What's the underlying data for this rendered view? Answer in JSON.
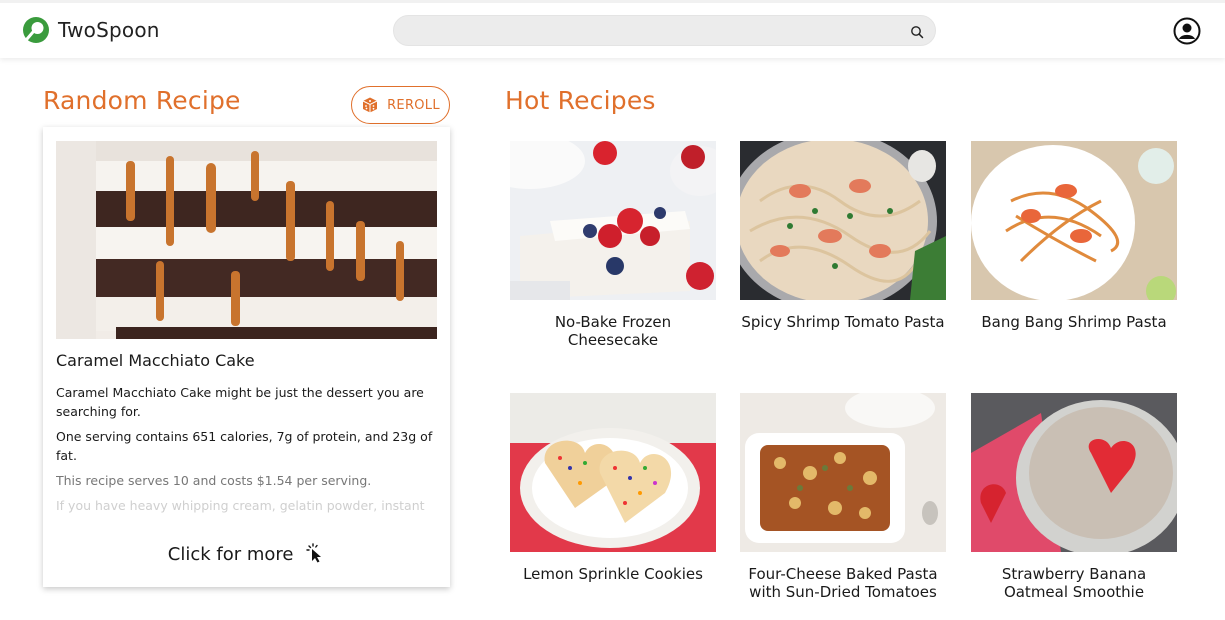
{
  "header": {
    "brand": "TwoSpoon",
    "search": {
      "value": "",
      "placeholder": ""
    },
    "icons": {
      "logo": "twospoon-logo-icon",
      "search": "search-icon",
      "account": "account-circle-icon"
    }
  },
  "random": {
    "title": "Random Recipe",
    "reroll_label": "REROLL",
    "reroll_icon": "dice-icon",
    "recipe_title": "Caramel Macchiato Cake",
    "desc": [
      "Caramel Macchiato Cake might be just the dessert you are searching for.",
      "One serving contains 651 calories, 7g of protein, and 23g of fat.",
      "This recipe serves 10 and costs $1.54 per serving.",
      "If you have heavy whipping cream, gelatin powder, instant"
    ],
    "more_label": "Click for more",
    "more_icon": "click-cursor-icon"
  },
  "hot": {
    "title": "Hot Recipes",
    "items": [
      {
        "label": "No-Bake Frozen Cheesecake"
      },
      {
        "label": "Spicy Shrimp Tomato Pasta"
      },
      {
        "label": "Bang Bang Shrimp Pasta"
      },
      {
        "label": "Lemon Sprinkle Cookies"
      },
      {
        "label": "Four-Cheese Baked Pasta with Sun-Dried Tomatoes"
      },
      {
        "label": "Strawberry Banana Oatmeal Smoothie"
      }
    ]
  },
  "colors": {
    "accent": "#e0702c",
    "logo": "#3a9b3d"
  }
}
